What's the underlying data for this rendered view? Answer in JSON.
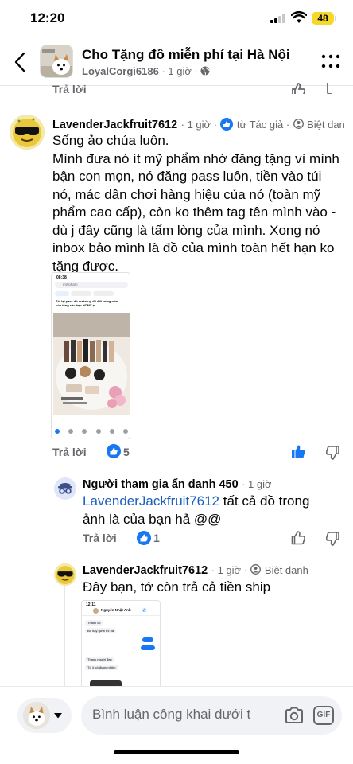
{
  "status": {
    "time": "12:20",
    "battery": "48"
  },
  "header": {
    "title": "Cho Tặng đồ miễn phí tại Hà Nội",
    "author": "LoyalCorgi6186",
    "time": "· 1 giờ ·"
  },
  "previous": {
    "reply_label": "Trả lời"
  },
  "comment1": {
    "author": "LavenderJackfruit7612",
    "time": "· 1 giờ ·",
    "author_badge": "từ Tác giả ·",
    "visibility": "Biệt dan",
    "lines": [
      "Sống ảo chúa luôn.",
      "Mình đưa nó ít mỹ phẩm nhờ đăng tặng vì mình",
      "bận con mọn, nó đăng pass luôn, tiền vào túi",
      "nó, mác dân chơi hàng hiệu của nó (toàn mỹ",
      "phẩm cao cấp), còn ko thêm tag tên mình vào -",
      "dù j đây cũng là tấm lòng của mình. Xong nó",
      "inbox bảo mình là đồ của mình toàn hết hạn ko",
      "tặng được."
    ],
    "screenshot": {
      "time": "08:38",
      "search": "mỹ phẩm",
      "post_line1": "Tôi lại pass đồ make up để đổi trùng nửa",
      "post_line2": "còn tặng các bạn HCMX ạ"
    },
    "reply_label": "Trả lời",
    "like_count": "5"
  },
  "reply1": {
    "author": "Người tham gia ẩn danh 450",
    "time": "· 1 giờ",
    "mention": "LavenderJackfruit7612",
    "text": " tất cả đồ trong",
    "text_line2": "ảnh là của bạn hả @@",
    "reply_label": "Trả lời",
    "like_count": "1"
  },
  "reply2": {
    "author": "LavenderJackfruit7612",
    "time": "· 1 giờ ·",
    "visibility": "Biệt danh",
    "text": "Đây bạn, tớ còn trả cả tiền ship",
    "chat": {
      "time": "12:11",
      "name": "Nguyễn Nhật Anh",
      "msg1": "Thank cô",
      "msg2": "Bo hay gưởi thì bả",
      "msg3": "Thank người đẹp",
      "msg4": "Tớ ô cô được nhỏm"
    }
  },
  "composer": {
    "placeholder": "Bình luận công khai dưới t",
    "gif_label": "GIF"
  },
  "colors": {
    "accent": "#1877f2",
    "mention": "#1a5fbf",
    "muted": "#65676b"
  }
}
